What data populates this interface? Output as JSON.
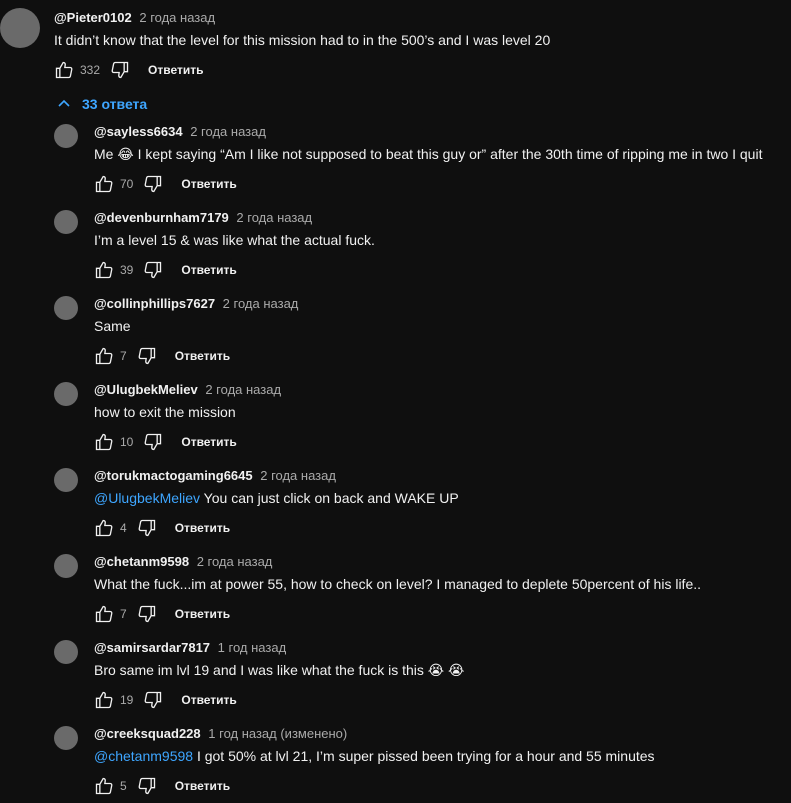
{
  "top_comment": {
    "author": "@Pieter0102",
    "time": "2 года назад",
    "text": "It didn’t know that the level for this mission had to in the 500’s and I was level 20",
    "likes": "332",
    "reply_label": "Ответить"
  },
  "replies_toggle": {
    "label": "33 ответа"
  },
  "replies": [
    {
      "author": "@sayless6634",
      "time": "2 года назад",
      "mention": "",
      "text": "Me 😂  I kept saying “Am I like not supposed to beat this guy or” after the 30th time of ripping me in two I quit",
      "likes": "70",
      "reply_label": "Ответить"
    },
    {
      "author": "@devenburnham7179",
      "time": "2 года назад",
      "mention": "",
      "text": "I’m a level 15 & was like what the actual fuck.",
      "likes": "39",
      "reply_label": "Ответить"
    },
    {
      "author": "@collinphillips7627",
      "time": "2 года назад",
      "mention": "",
      "text": "Same",
      "likes": "7",
      "reply_label": "Ответить"
    },
    {
      "author": "@UlugbekMeliev",
      "time": "2 года назад",
      "mention": "",
      "text": "how to exit the mission",
      "likes": "10",
      "reply_label": "Ответить"
    },
    {
      "author": "@torukmactogaming6645",
      "time": "2 года назад",
      "mention": "@UlugbekMeliev",
      "text": "  You can just click on back and WAKE UP",
      "likes": "4",
      "reply_label": "Ответить"
    },
    {
      "author": "@chetanm9598",
      "time": "2 года назад",
      "mention": "",
      "text": "What the fuck...im at power 55, how to check on level? I managed to deplete 50percent of his life..",
      "likes": "7",
      "reply_label": "Ответить"
    },
    {
      "author": "@samirsardar7817",
      "time": "1 год назад",
      "mention": "",
      "text": "Bro same im lvl 19 and I was like what the fuck is this 😭 😭",
      "likes": "19",
      "reply_label": "Ответить"
    },
    {
      "author": "@creeksquad228",
      "time": "1 год назад (изменено)",
      "mention": "@chetanm9598",
      "text": " I got 50% at lvl 21, I’m super pissed been trying for a hour and 55 minutes",
      "likes": "5",
      "reply_label": "Ответить"
    }
  ]
}
